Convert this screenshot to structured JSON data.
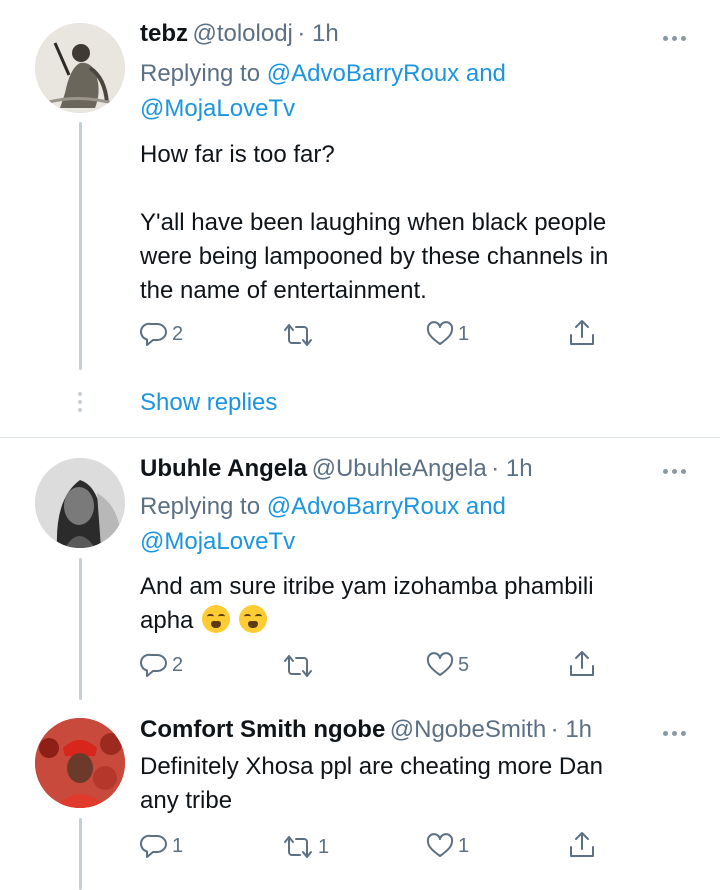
{
  "tweets": [
    {
      "display_name": "tebz",
      "handle": "@tololodj",
      "time": "· 1h",
      "replying_prefix": "Replying to ",
      "replying_user_1": "@AdvoBarryRoux",
      "replying_and": " and",
      "replying_user_2": "@MojaLoveTv",
      "text_line_1": "How far is too far?",
      "text_line_2": "Y'all have been laughing when black people",
      "text_line_3": "were being lampooned by these channels in",
      "text_line_4": "the name of entertainment.",
      "replies": "2",
      "retweets": "",
      "likes": "1"
    },
    {
      "display_name": "Ubuhle Angela",
      "handle": "@UbuhleAngela",
      "time": "· 1h",
      "replying_prefix": "Replying to ",
      "replying_user_1": "@AdvoBarryRoux",
      "replying_and": " and",
      "replying_user_2": "@MojaLoveTv",
      "text_line_1": "And am sure itribe yam izohamba phambili",
      "text_line_2": "apha",
      "replies": "2",
      "retweets": "",
      "likes": "5"
    },
    {
      "display_name": "Comfort Smith ngobe",
      "handle": "@NgobeSmith",
      "time": "· 1h",
      "text_line_1": "Definitely Xhosa ppl are cheating more Dan",
      "text_line_2": "any tribe",
      "replies": "1",
      "retweets": "1",
      "likes": "1"
    }
  ],
  "show_replies_label": "Show replies",
  "icons": {
    "reply": "reply-icon",
    "retweet": "retweet-icon",
    "like": "heart-icon",
    "share": "share-icon",
    "more": "more-icon"
  },
  "colors": {
    "link": "#1b95e0",
    "secondary": "#5b7083",
    "thread_line": "#c4cfd6"
  }
}
